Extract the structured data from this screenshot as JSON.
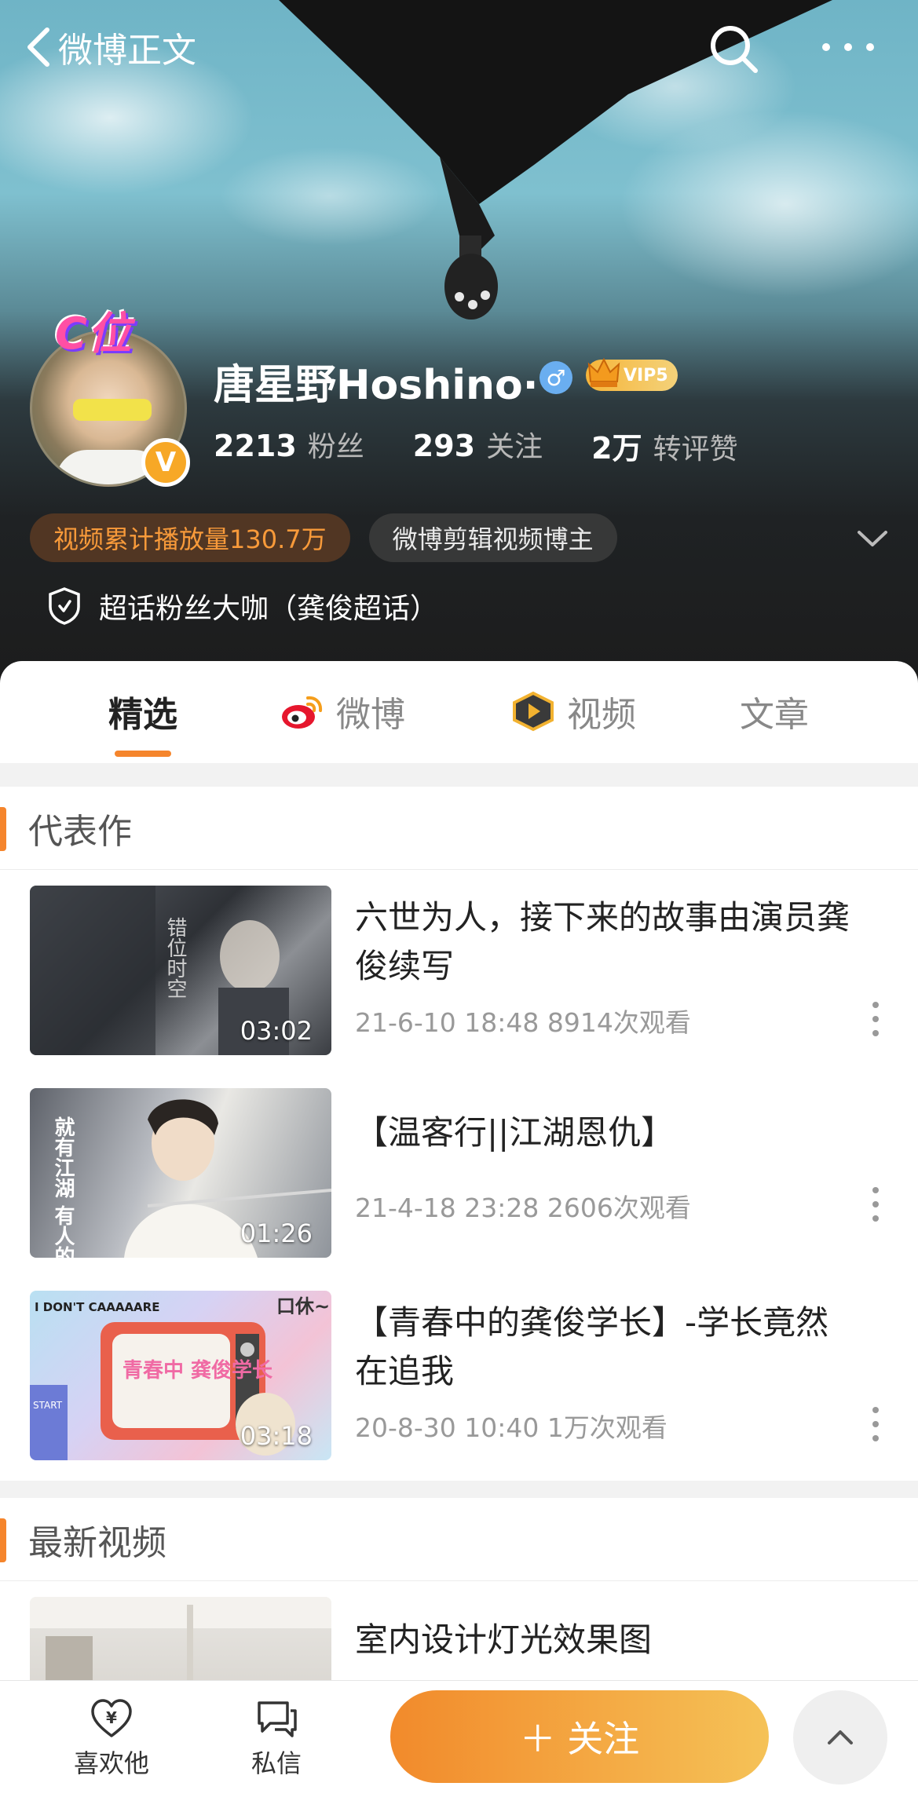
{
  "nav": {
    "title": "微博正文"
  },
  "profile": {
    "crown_text": "C位",
    "verify_mark": "V",
    "name": "唐星野Hoshino·",
    "gender_symbol": "♂",
    "vip_label": "VIP5",
    "stats": [
      {
        "value": "2213",
        "label": "粉丝"
      },
      {
        "value": "293",
        "label": "关注"
      },
      {
        "value": "2万",
        "label": "转评赞"
      }
    ],
    "tags": [
      "视频累计播放量130.7万",
      "微博剪辑视频博主"
    ],
    "honor": "超话粉丝大咖（龚俊超话）"
  },
  "tabs": [
    {
      "label": "精选"
    },
    {
      "label": "微博"
    },
    {
      "label": "视频"
    },
    {
      "label": "文章"
    }
  ],
  "sections": {
    "featured": {
      "title": "代表作",
      "videos": [
        {
          "title": "六世为人，接下来的故事由演员龚俊续写",
          "meta": "21-6-10 18:48 8914次观看",
          "duration": "03:02"
        },
        {
          "title": "【温客行||江湖恩仇】",
          "meta": "21-4-18 23:28 2606次观看",
          "duration": "01:26"
        },
        {
          "title": "【青春中的龚俊学长】-学长竟然在追我",
          "meta": "20-8-30 10:40 1万次观看",
          "duration": "03:18"
        }
      ]
    },
    "latest": {
      "title": "最新视频",
      "videos": [
        {
          "title": "室内设计灯光效果图"
        }
      ]
    }
  },
  "thumb_text": {
    "v1": "错位时空",
    "v2": "就有江湖 有人的地方",
    "v3_sticker": "I DON'T CAAAAARE",
    "v3_tv": "青春中 龚俊学长",
    "v3_side": "口休~",
    "v3_game": "START"
  },
  "bottom_bar": {
    "like_label": "喜欢他",
    "message_label": "私信",
    "follow_label": "＋ 关注"
  },
  "colors": {
    "accent": "#f5852c",
    "follow_gradient_start": "#f28a2b",
    "follow_gradient_end": "#f5c257",
    "tag_orange": "#f89a3a",
    "gender_blue": "#6aaef0"
  }
}
